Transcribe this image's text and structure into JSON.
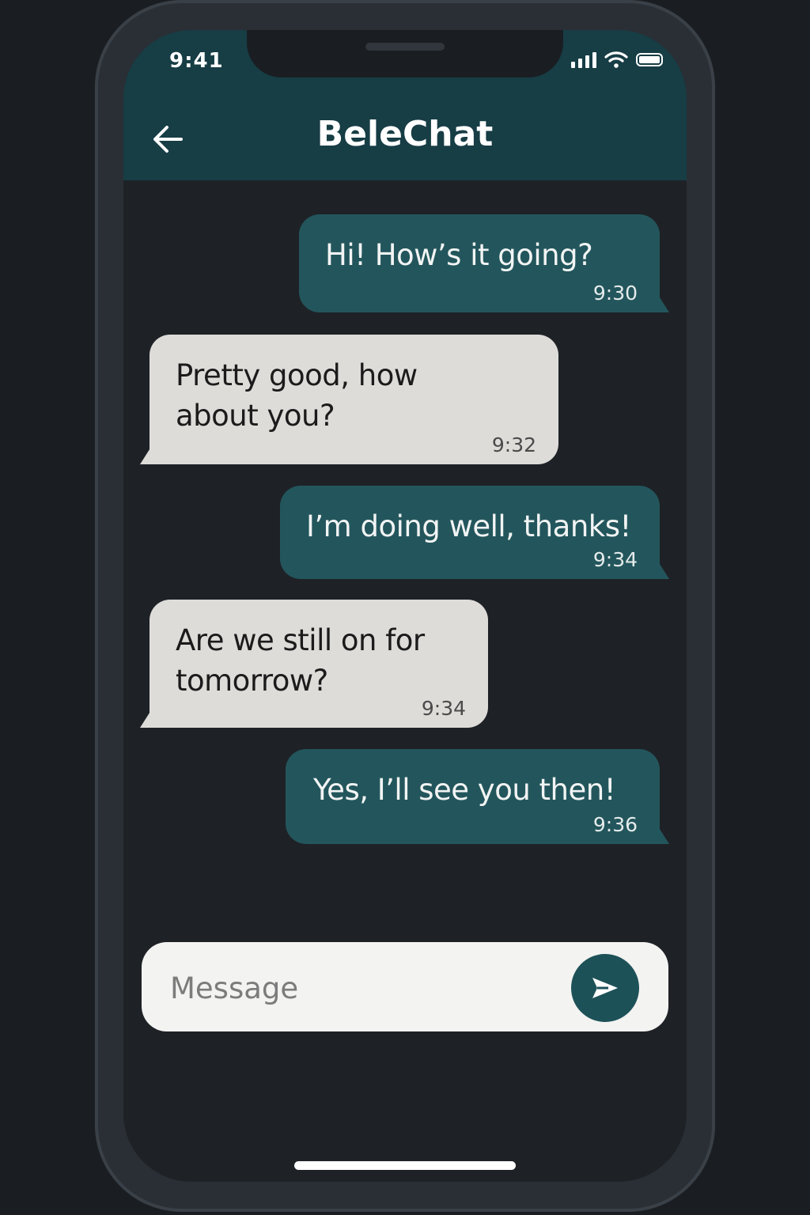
{
  "status_bar": {
    "time": "9:41",
    "icons": [
      "signal-icon",
      "wifi-icon",
      "battery-icon"
    ]
  },
  "header": {
    "title": "BeleChat",
    "back_icon": "arrow-left-icon"
  },
  "messages": [
    {
      "direction": "outgoing",
      "text": "Hi! How’s it going?",
      "time": "9:30"
    },
    {
      "direction": "incoming",
      "text": "Pretty good, how about you?",
      "time": "9:32"
    },
    {
      "direction": "outgoing",
      "text": "I’m doing well, thanks!",
      "time": "9:34"
    },
    {
      "direction": "incoming",
      "text": "Are we still on for tomorrow?",
      "time": "9:34"
    },
    {
      "direction": "outgoing",
      "text": "Yes, I’ll see you then!",
      "time": "9:36"
    }
  ],
  "composer": {
    "placeholder": "Message",
    "value": "",
    "send_icon": "send-icon"
  },
  "colors": {
    "header_bg": "#173d45",
    "outgoing_bubble": "#23565c",
    "incoming_bubble": "#dedcd9",
    "screen_bg": "#1e2227",
    "send_button": "#1d5158"
  }
}
